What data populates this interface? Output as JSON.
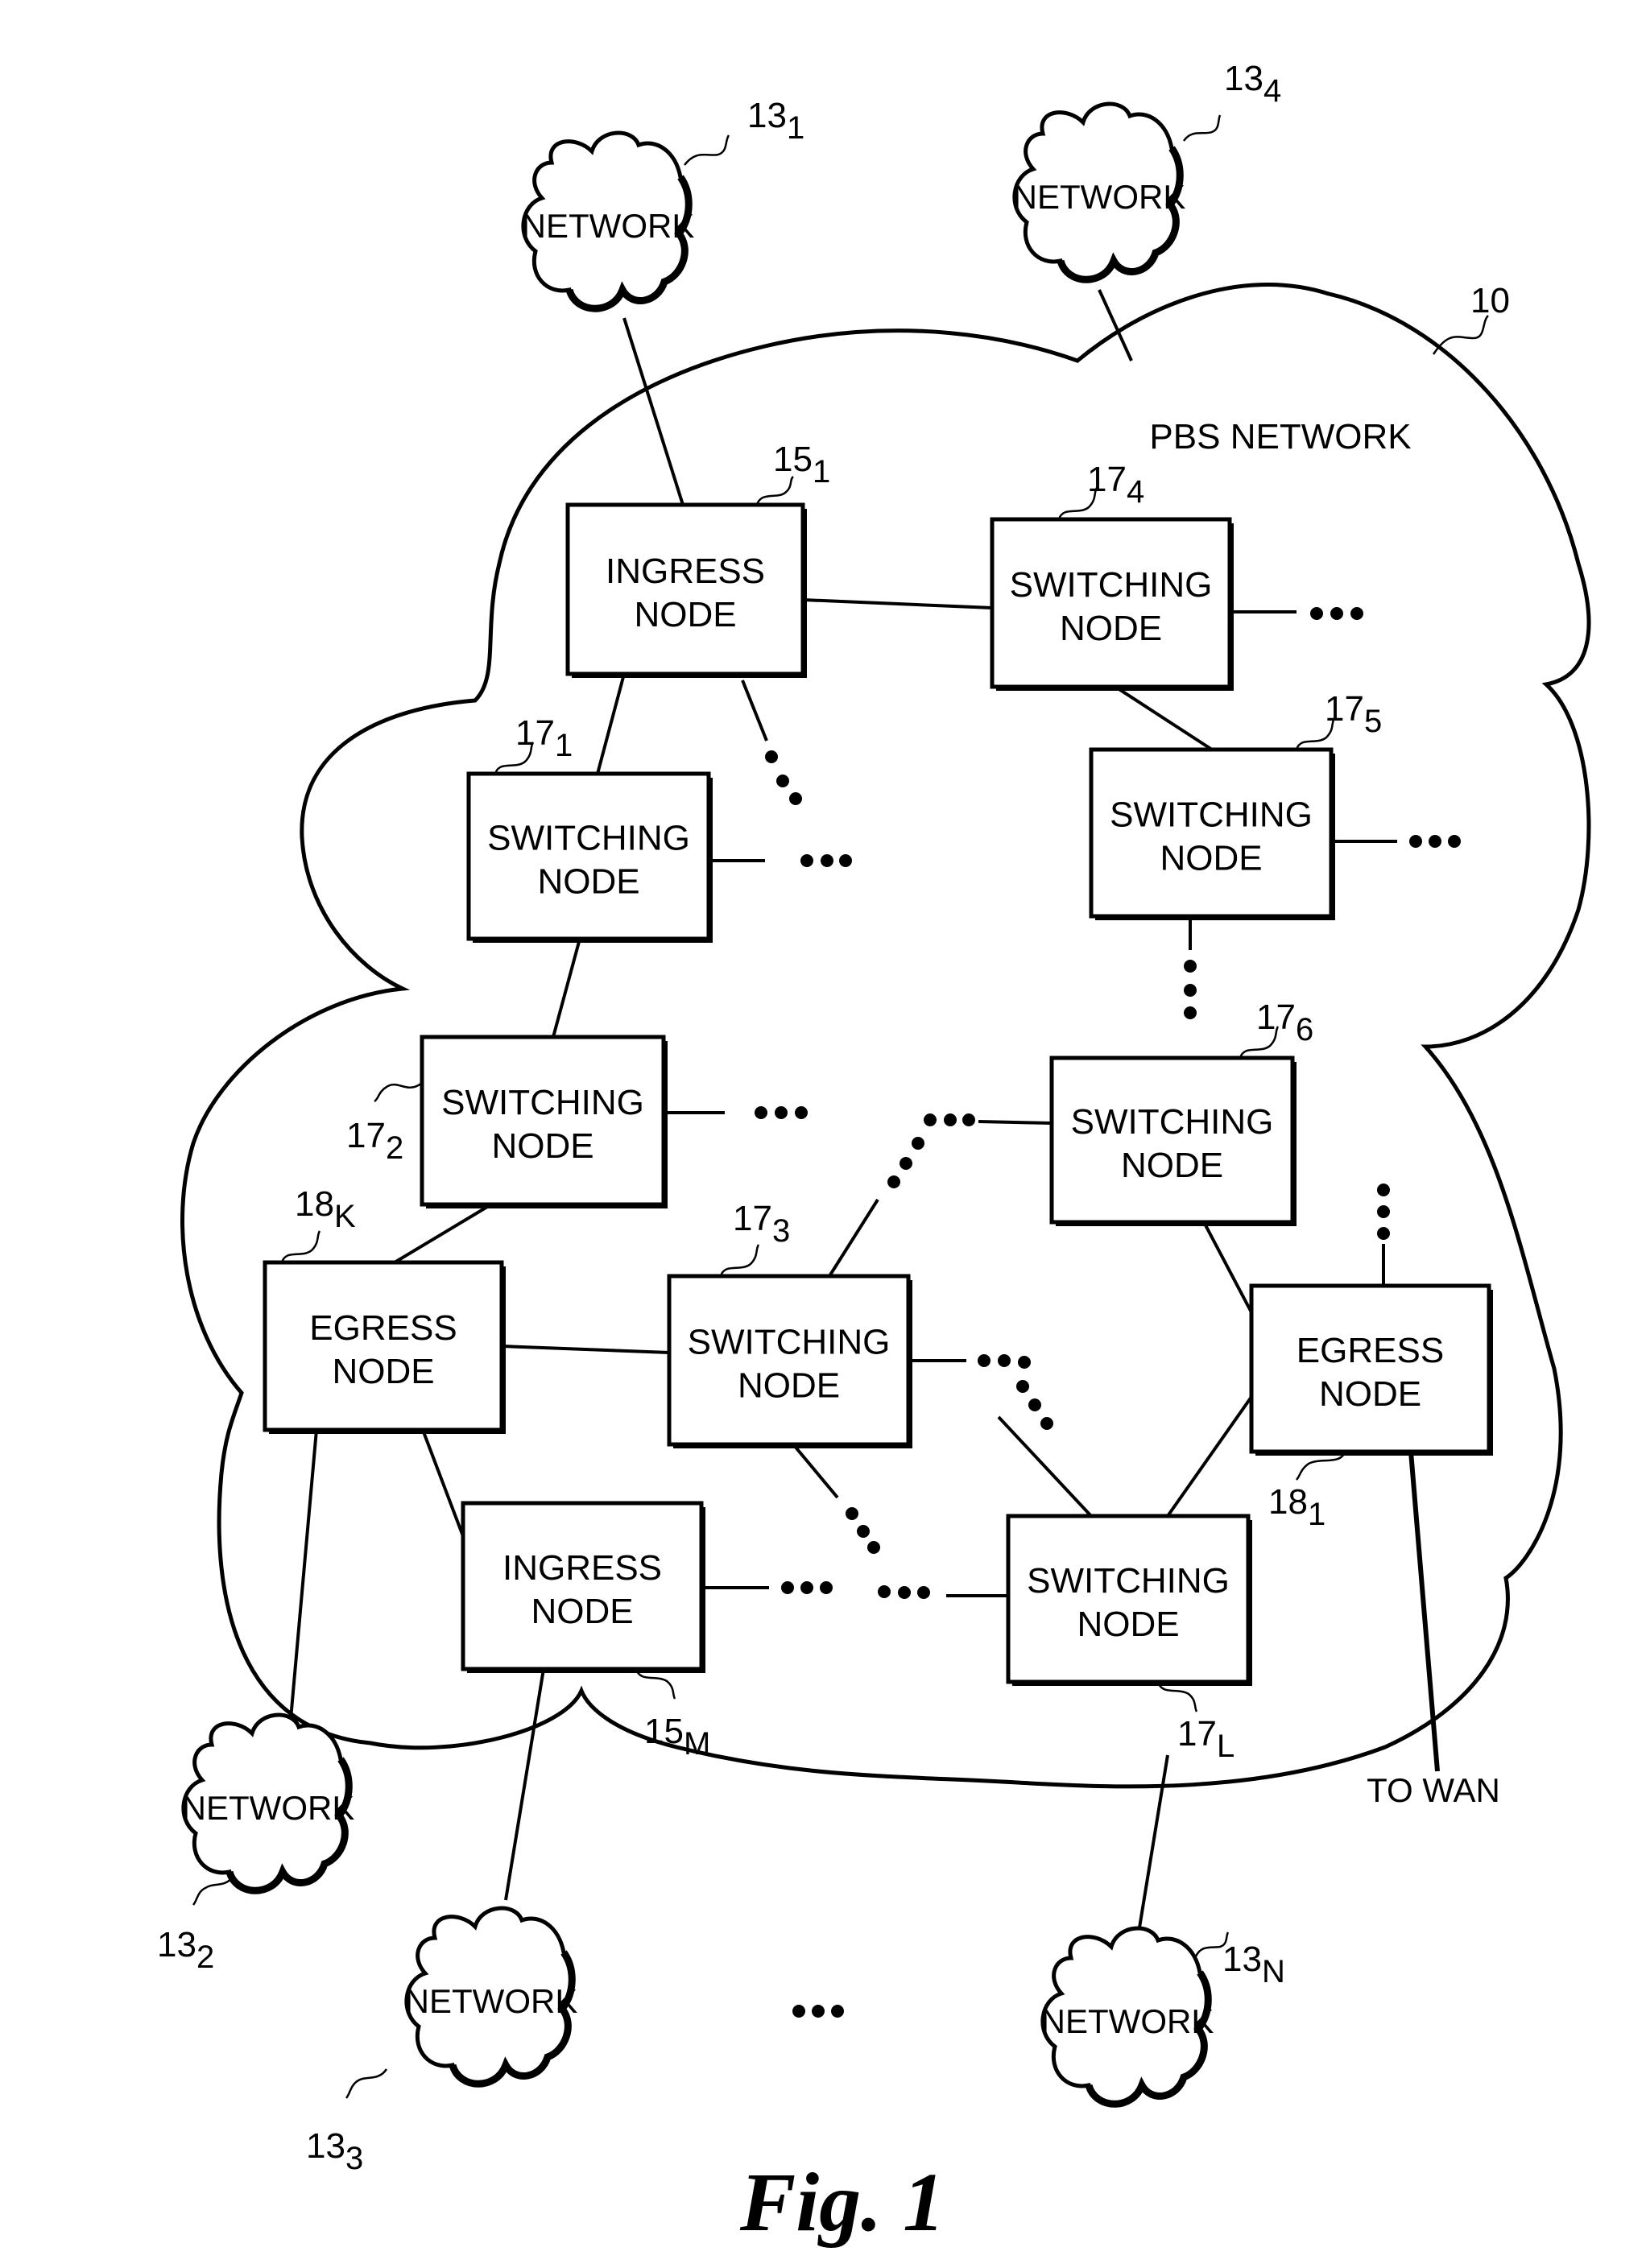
{
  "figure": {
    "caption": "Fig. 1",
    "main_network": {
      "label": "PBS NETWORK",
      "ref": "10"
    },
    "networks": [
      {
        "id": "net-13-1",
        "label": "NETWORK",
        "ref": "13",
        "sub": "1"
      },
      {
        "id": "net-13-4",
        "label": "NETWORK",
        "ref": "13",
        "sub": "4"
      },
      {
        "id": "net-13-2",
        "label": "NETWORK",
        "ref": "13",
        "sub": "2"
      },
      {
        "id": "net-13-3",
        "label": "NETWORK",
        "ref": "13",
        "sub": "3"
      },
      {
        "id": "net-13-N",
        "label": "NETWORK",
        "ref": "13",
        "sub": "N"
      }
    ],
    "nodes": [
      {
        "id": "ingress-15-1",
        "line1": "INGRESS",
        "line2": "NODE",
        "ref": "15",
        "sub": "1"
      },
      {
        "id": "switch-17-4",
        "line1": "SWITCHING",
        "line2": "NODE",
        "ref": "17",
        "sub": "4"
      },
      {
        "id": "switch-17-1",
        "line1": "SWITCHING",
        "line2": "NODE",
        "ref": "17",
        "sub": "1"
      },
      {
        "id": "switch-17-5",
        "line1": "SWITCHING",
        "line2": "NODE",
        "ref": "17",
        "sub": "5"
      },
      {
        "id": "switch-17-2",
        "line1": "SWITCHING",
        "line2": "NODE",
        "ref": "17",
        "sub": "2"
      },
      {
        "id": "switch-17-6",
        "line1": "SWITCHING",
        "line2": "NODE",
        "ref": "17",
        "sub": "6"
      },
      {
        "id": "egress-18-K",
        "line1": "EGRESS",
        "line2": "NODE",
        "ref": "18",
        "sub": "K"
      },
      {
        "id": "switch-17-3",
        "line1": "SWITCHING",
        "line2": "NODE",
        "ref": "17",
        "sub": "3"
      },
      {
        "id": "egress-18-1",
        "line1": "EGRESS",
        "line2": "NODE",
        "ref": "18",
        "sub": "1"
      },
      {
        "id": "ingress-15-M",
        "line1": "INGRESS",
        "line2": "NODE",
        "ref": "15",
        "sub": "M"
      },
      {
        "id": "switch-17-L",
        "line1": "SWITCHING",
        "line2": "NODE",
        "ref": "17",
        "sub": "L"
      }
    ],
    "wan_label": "TO WAN",
    "ellipsis": "•••"
  }
}
